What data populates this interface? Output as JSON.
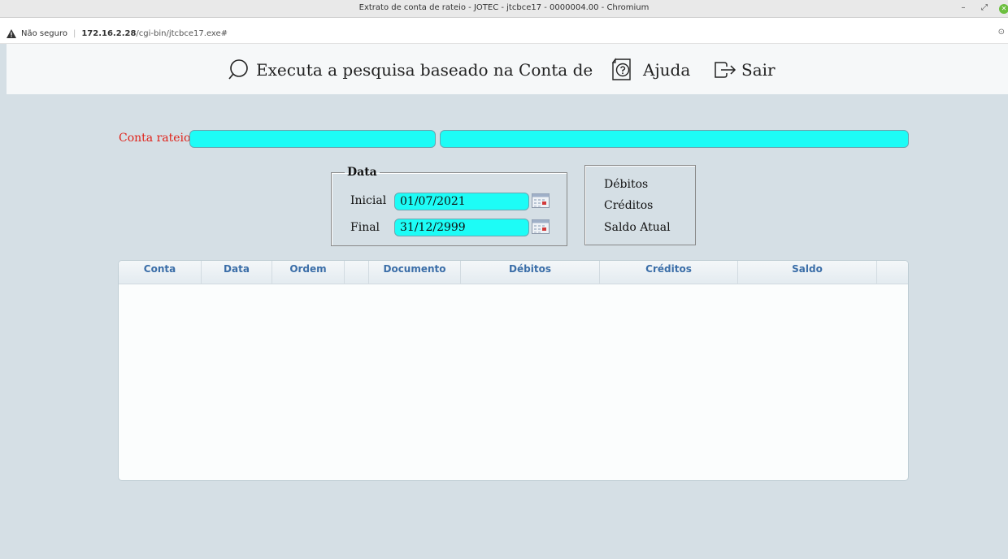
{
  "window": {
    "title": "Extrato de conta de rateio - JOTEC - jtcbce17 - 0000004.00 - Chromium",
    "minimize": "–",
    "restore": "⤢",
    "close": "✕"
  },
  "addressbar": {
    "security_text": "Não seguro",
    "host": "172.16.2.28",
    "path": "/cgi-bin/jtcbce17.exe#",
    "right_icon": "⊙"
  },
  "toolbar": {
    "search_label": "Executa a pesquisa baseado na Conta de",
    "help_label": "Ajuda",
    "exit_label": "Sair"
  },
  "form": {
    "conta_rateio_label": "Conta rateio",
    "conta_rateio_code": "",
    "conta_rateio_desc": "",
    "data_legend": "Data",
    "inicial_label": "Inicial",
    "inicial_value": "01/07/2021",
    "final_label": "Final",
    "final_value": "31/12/2999"
  },
  "totals": {
    "debitos": "Débitos",
    "creditos": "Créditos",
    "saldo_atual": "Saldo Atual"
  },
  "grid": {
    "columns": [
      "Conta",
      "Data",
      "Ordem",
      "",
      "Documento",
      "Débitos",
      "Créditos",
      "Saldo",
      ""
    ],
    "rows": []
  },
  "colors": {
    "input_bg": "#1dfcf6",
    "label_red": "#e0231a",
    "header_text": "#3b6ea8",
    "page_bg": "#d5dfe5"
  },
  "icons": {
    "search": "search-icon",
    "help": "help-icon",
    "exit": "exit-icon",
    "calendar": "calendar-icon",
    "warning": "warning-icon"
  }
}
